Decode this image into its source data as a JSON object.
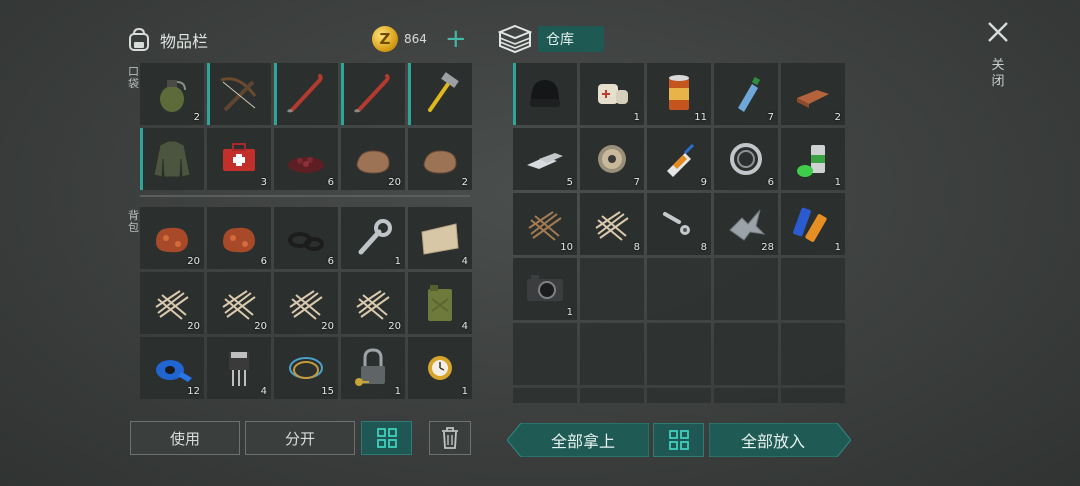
{
  "inventory": {
    "title": "物品栏",
    "coins": "864",
    "coin_symbol": "Z",
    "pocket_label": "口袋",
    "backpack_label": "背包",
    "pocket_items": [
      {
        "icon": "grenade-icon",
        "qty": "2",
        "mark": false
      },
      {
        "icon": "crossbow-icon",
        "qty": "",
        "mark": true
      },
      {
        "icon": "crowbar-icon",
        "qty": "",
        "mark": true
      },
      {
        "icon": "crowbar-icon",
        "qty": "",
        "mark": true
      },
      {
        "icon": "hammer-icon",
        "qty": "",
        "mark": true
      },
      {
        "icon": "jacket-icon",
        "qty": "",
        "mark": true
      },
      {
        "icon": "medkit-icon",
        "qty": "3",
        "mark": false
      },
      {
        "icon": "berries-icon",
        "qty": "6",
        "mark": false
      },
      {
        "icon": "stone-icon",
        "qty": "20",
        "mark": false
      },
      {
        "icon": "stone-icon",
        "qty": "2",
        "mark": false
      }
    ],
    "backpack_items": [
      {
        "icon": "iron-ore-icon",
        "qty": "20"
      },
      {
        "icon": "iron-ore-icon",
        "qty": "6"
      },
      {
        "icon": "rubber-rings-icon",
        "qty": "6"
      },
      {
        "icon": "wrench-icon",
        "qty": "1"
      },
      {
        "icon": "fabric-icon",
        "qty": "4"
      },
      {
        "icon": "fiber-icon",
        "qty": "20"
      },
      {
        "icon": "fiber-icon",
        "qty": "20"
      },
      {
        "icon": "fiber-icon",
        "qty": "20"
      },
      {
        "icon": "fiber-icon",
        "qty": "20"
      },
      {
        "icon": "jerrycan-icon",
        "qty": "4"
      },
      {
        "icon": "tape-icon",
        "qty": "12"
      },
      {
        "icon": "transistor-icon",
        "qty": "4"
      },
      {
        "icon": "wires-icon",
        "qty": "15"
      },
      {
        "icon": "padlock-icon",
        "qty": "1"
      },
      {
        "icon": "watch-icon",
        "qty": "1"
      }
    ]
  },
  "warehouse": {
    "title": "仓库",
    "items": [
      {
        "icon": "beanie-icon",
        "qty": "",
        "mark": true
      },
      {
        "icon": "bandage-icon",
        "qty": "1"
      },
      {
        "icon": "can-icon",
        "qty": "11"
      },
      {
        "icon": "water-bottle-icon",
        "qty": "7"
      },
      {
        "icon": "copper-bar-icon",
        "qty": "2"
      },
      {
        "icon": "metal-bars-icon",
        "qty": "5"
      },
      {
        "icon": "wire-spool-icon",
        "qty": "7"
      },
      {
        "icon": "glue-icon",
        "qty": "9"
      },
      {
        "icon": "bearing-icon",
        "qty": "6"
      },
      {
        "icon": "spray-can-icon",
        "qty": "1"
      },
      {
        "icon": "fiber-brown-icon",
        "qty": "10"
      },
      {
        "icon": "fiber-icon",
        "qty": "8"
      },
      {
        "icon": "bolt-nut-icon",
        "qty": "8"
      },
      {
        "icon": "scrap-metal-icon",
        "qty": "28"
      },
      {
        "icon": "batteries-icon",
        "qty": "1"
      },
      {
        "icon": "camera-icon",
        "qty": "1"
      }
    ],
    "empty_slots": 14
  },
  "buttons": {
    "use": "使用",
    "split": "分开",
    "take_all": "全部拿上",
    "put_all": "全部放入"
  },
  "close_label": "关闭",
  "colors": {
    "accent": "#2fa59a",
    "button_teal": "#1e5753"
  }
}
